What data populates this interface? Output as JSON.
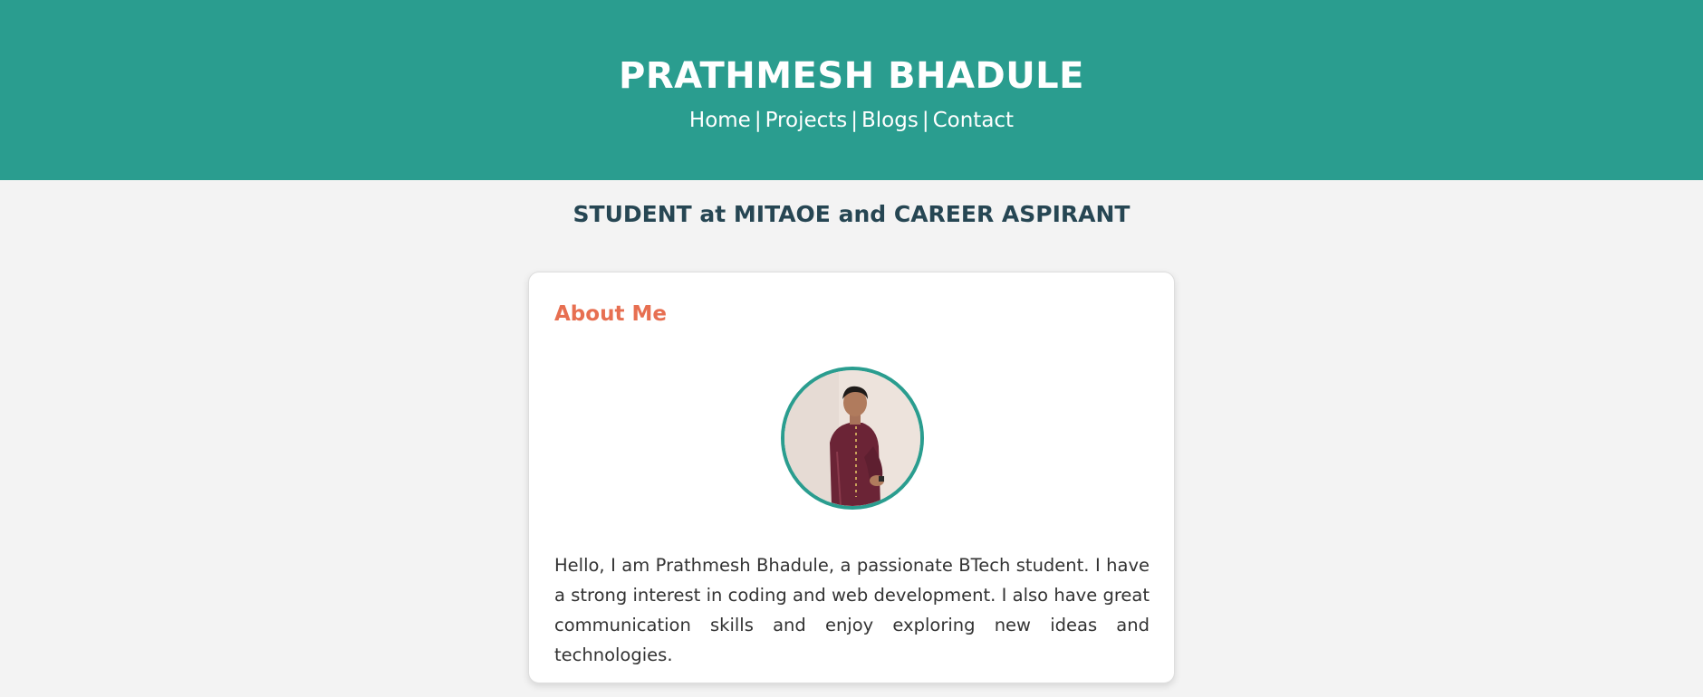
{
  "header": {
    "title": "PRATHMESH BHADULE",
    "nav": [
      {
        "label": "Home"
      },
      {
        "label": "Projects"
      },
      {
        "label": "Blogs"
      },
      {
        "label": "Contact"
      }
    ],
    "separator": "|"
  },
  "tagline": "STUDENT at MITAOE and CAREER ASPIRANT",
  "about": {
    "title": "About Me",
    "avatar_icon": "profile-photo",
    "bio": "Hello, I am Prathmesh Bhadule, a passionate BTech student. I have a strong interest in coding and web development. I also have great communication skills and enjoy exploring new ideas and technologies."
  },
  "colors": {
    "header_bg": "#2a9d8f",
    "tagline": "#264653",
    "about_title": "#e76f51",
    "avatar_border": "#2a9d8f",
    "page_bg": "#f3f3f3"
  }
}
